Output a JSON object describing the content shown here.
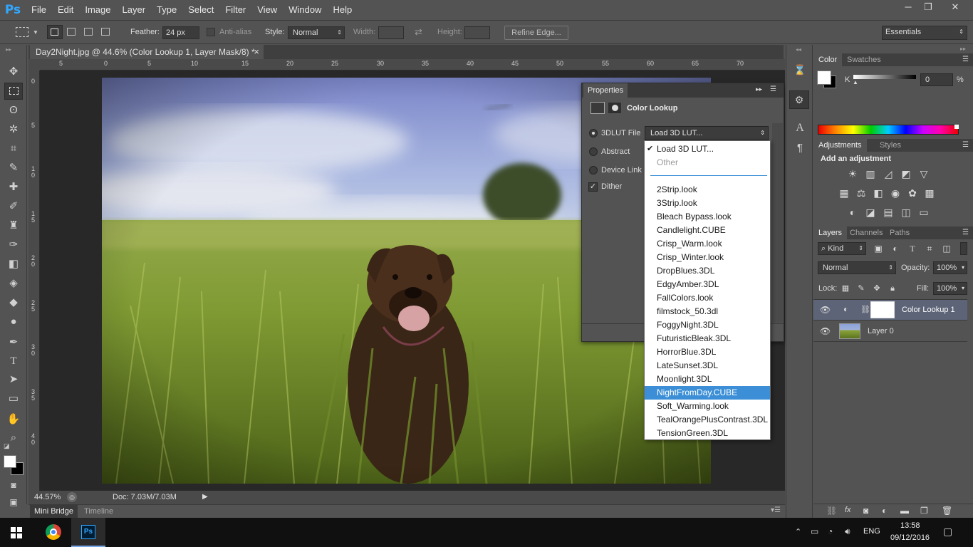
{
  "app": {
    "logo": "Ps",
    "window_controls": [
      "─",
      "❐",
      "✕"
    ]
  },
  "menu": [
    "File",
    "Edit",
    "Image",
    "Layer",
    "Type",
    "Select",
    "Filter",
    "View",
    "Window",
    "Help"
  ],
  "options_bar": {
    "feather_label": "Feather:",
    "feather_value": "24 px",
    "antialias_label": "Anti-alias",
    "style_label": "Style:",
    "style_value": "Normal",
    "width_label": "Width:",
    "height_label": "Height:",
    "refine_edge": "Refine Edge...",
    "workspace": "Essentials"
  },
  "document": {
    "tab_title": "Day2Night.jpg @ 44.6% (Color Lookup 1, Layer Mask/8) *",
    "close": "×"
  },
  "rulers": {
    "top": [
      "5",
      "0",
      "5",
      "10",
      "15",
      "20",
      "25",
      "30",
      "35",
      "40",
      "45",
      "50",
      "55",
      "60",
      "65",
      "70"
    ],
    "left": [
      "0",
      "5",
      "1 0",
      "1 5",
      "2 0",
      "2 5",
      "3 0",
      "3 5",
      "4 0"
    ]
  },
  "status": {
    "zoom": "44.57%",
    "doc": "Doc: 7.03M/7.03M"
  },
  "bottom_tabs": [
    "Mini Bridge",
    "Timeline"
  ],
  "properties": {
    "title": "Properties",
    "adjustment": "Color Lookup",
    "options": [
      {
        "label": "3DLUT File",
        "selected": true
      },
      {
        "label": "Abstract",
        "selected": false
      },
      {
        "label": "Device Link",
        "selected": false
      }
    ],
    "dither_label": "Dither",
    "lut_select_value": "Load 3D LUT..."
  },
  "lut_dropdown": {
    "checked_item": "Load 3D LUT...",
    "other": "Other",
    "items": [
      "2Strip.look",
      "3Strip.look",
      "Bleach Bypass.look",
      "Candlelight.CUBE",
      "Crisp_Warm.look",
      "Crisp_Winter.look",
      "DropBlues.3DL",
      "EdgyAmber.3DL",
      "FallColors.look",
      "filmstock_50.3dl",
      "FoggyNight.3DL",
      "FuturisticBleak.3DL",
      "HorrorBlue.3DL",
      "LateSunset.3DL",
      "Moonlight.3DL",
      "NightFromDay.CUBE",
      "Soft_Warming.look",
      "TealOrangePlusContrast.3DL",
      "TensionGreen.3DL"
    ],
    "highlighted": "NightFromDay.CUBE"
  },
  "color_panel": {
    "tabs": [
      "Color",
      "Swatches"
    ],
    "k_label": "K",
    "k_value": "0",
    "unit": "%"
  },
  "adjustments_panel": {
    "tabs": [
      "Adjustments",
      "Styles"
    ],
    "heading": "Add an adjustment"
  },
  "layers_panel": {
    "tabs": [
      "Layers",
      "Channels",
      "Paths"
    ],
    "kind": "Kind",
    "blend_mode": "Normal",
    "opacity_label": "Opacity:",
    "opacity_value": "100%",
    "lock_label": "Lock:",
    "fill_label": "Fill:",
    "fill_value": "100%",
    "layers": [
      {
        "name": "Color Lookup 1",
        "selected": true
      },
      {
        "name": "Layer 0",
        "selected": false
      }
    ]
  },
  "taskbar": {
    "language": "ENG",
    "time": "13:58",
    "date": "09/12/2016"
  },
  "colors": {
    "accent": "#3c8fd6",
    "panel": "#535353",
    "dark": "#3a3a3a"
  }
}
